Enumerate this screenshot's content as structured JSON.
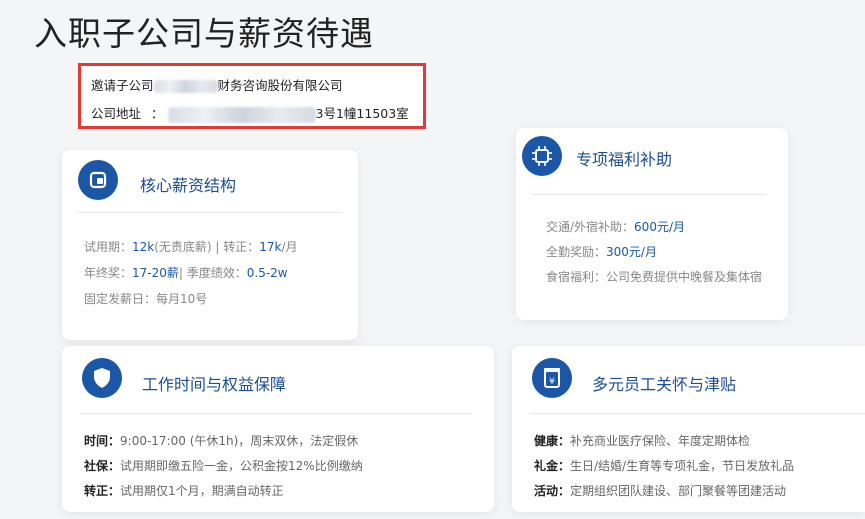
{
  "page_title": "入职子公司与薪资待遇",
  "company": {
    "name_prefix": "邀请子公司",
    "name_suffix": "财务咨询股份有限公司",
    "address_label": "公司地址",
    "address_colon": "：",
    "address_suffix": "3号1幢11503室"
  },
  "salary_card": {
    "title": "核心薪资结构",
    "rows": [
      {
        "k1": "试用期：",
        "v1": "12k",
        "m1": "(无责底薪) | 转正：",
        "v2": "17k",
        "m2": "/月"
      },
      {
        "k1": "年终奖：",
        "v1": "17-20薪",
        "m1": "| 季度绩效：",
        "v2": "0.5-2w",
        "m2": ""
      },
      {
        "k1": "固定发薪日：",
        "v1": "",
        "m1": "每月10号",
        "v2": "",
        "m2": ""
      }
    ]
  },
  "benefit_card": {
    "title": "专项福利补助",
    "rows": [
      {
        "k": "交通/外宿补助：",
        "v": "600元/月",
        "m": ""
      },
      {
        "k": "全勤奖励：",
        "v": "300元/月",
        "m": ""
      },
      {
        "k": "食宿福利：",
        "v": "",
        "m": "公司免费提供中晚餐及集体宿"
      }
    ]
  },
  "worktime_card": {
    "title": "工作时间与权益保障",
    "rows": [
      {
        "k": "时间：",
        "t": "9:00-17:00 (午休1h)，周末双休，法定假休"
      },
      {
        "k": "社保：",
        "t": "试用期即缴五险一金，公积金按12%比例缴纳"
      },
      {
        "k": "转正：",
        "t": "试用期仅1个月，期满自动转正"
      }
    ]
  },
  "care_card": {
    "title": "多元员工关怀与津贴",
    "rows": [
      {
        "k": "健康：",
        "t": "补充商业医疗保险、年度定期体检"
      },
      {
        "k": "礼金：",
        "t": "生日/结婚/生育等专项礼金，节日发放礼品"
      },
      {
        "k": "活动：",
        "t": "定期组织团队建设、部门聚餐等团建活动"
      }
    ]
  },
  "colors": {
    "accent": "#1b57a6",
    "highlight_border": "#e53935"
  },
  "icons": [
    "wallet-icon",
    "chip-icon",
    "shield-icon",
    "money-box-icon"
  ]
}
